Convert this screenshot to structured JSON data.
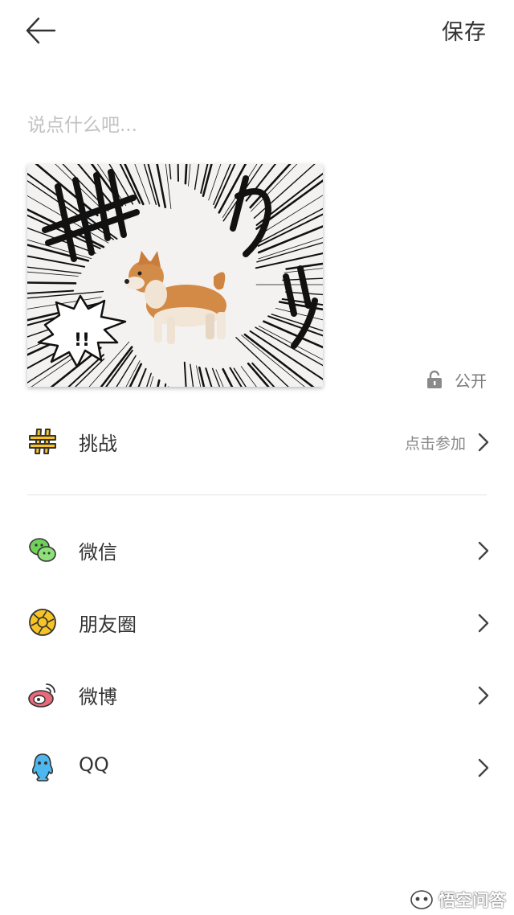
{
  "header": {
    "save_label": "保存",
    "back_icon": "arrow-left-icon"
  },
  "caption": {
    "value": "",
    "placeholder": "说点什么吧..."
  },
  "media": {
    "description_icon": "manga-shiba-photo"
  },
  "privacy": {
    "label": "公开",
    "icon": "lock-icon"
  },
  "challenge": {
    "label": "挑战",
    "hint": "点击参加",
    "icon": "hashtag-icon",
    "icon_color": "#f7c325"
  },
  "share": [
    {
      "label": "微信",
      "icon": "wechat-icon",
      "color": "#6fd05a"
    },
    {
      "label": "朋友圈",
      "icon": "moments-icon",
      "color": "#f7c325"
    },
    {
      "label": "微博",
      "icon": "weibo-icon",
      "color": "#e96a7b"
    },
    {
      "label": "QQ",
      "icon": "qq-icon",
      "color": "#4db8f0"
    }
  ],
  "watermark": {
    "text": "悟空问答"
  },
  "colors": {
    "text_primary": "#333333",
    "text_secondary": "#888888",
    "placeholder": "#c2c2c2",
    "divider": "#e3e3e3"
  }
}
